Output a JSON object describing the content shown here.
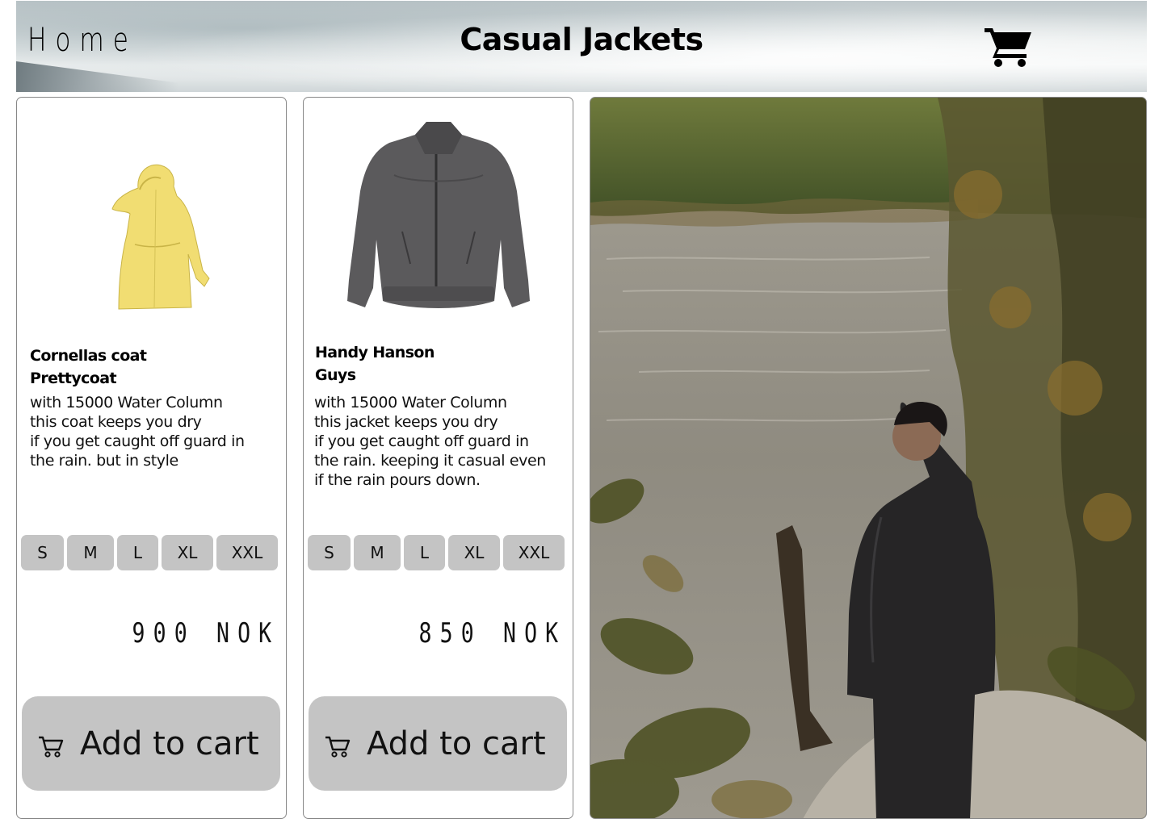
{
  "header": {
    "home_label": "Home",
    "title": "Casual Jackets",
    "cart_icon": "shopping-cart-icon"
  },
  "products": [
    {
      "name_lines": [
        "Cornellas coat",
        "Prettycoat"
      ],
      "description_lines": [
        "with 15000 Water Column",
        "this coat keeps you dry",
        "if you get caught  off guard in",
        "the rain. but in style"
      ],
      "sizes": [
        "S",
        "M",
        "L",
        "XL",
        "XXL"
      ],
      "price": "900 NOK",
      "add_to_cart_label": "Add to cart",
      "image": "yellow-raincoat"
    },
    {
      "name_lines": [
        "Handy Hanson",
        "Guys"
      ],
      "description_lines": [
        "with 15000 Water Column",
        "this jacket keeps you dry",
        "if you get caught  off guard in",
        "the rain. keeping it casual even",
        "if the rain pours down."
      ],
      "sizes": [
        "S",
        "M",
        "L",
        "XL",
        "XXL"
      ],
      "price": "850 NOK",
      "add_to_cart_label": "Add to cart",
      "image": "grey-jacket"
    }
  ],
  "hero_photo": "man-in-rain-jacket-by-river",
  "colors": {
    "button_bg": "#c4c4c4",
    "card_border": "#888888",
    "yellow_coat": "#f1dd72",
    "grey_jacket": "#5b5a5c"
  }
}
